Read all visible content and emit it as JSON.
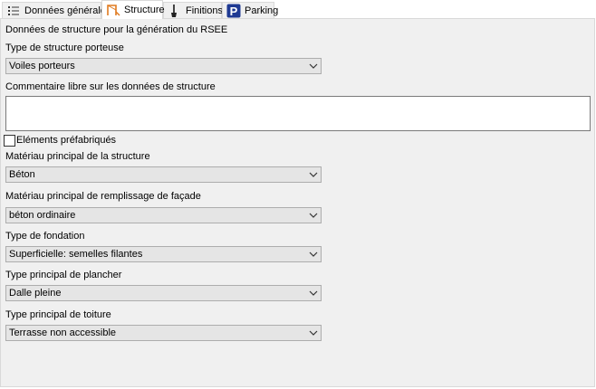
{
  "tabs": [
    {
      "label": "Données générales",
      "icon": "list-icon",
      "active": false
    },
    {
      "label": "Structure",
      "icon": "structure-icon",
      "active": true
    },
    {
      "label": "Finitions",
      "icon": "paint-brush-icon",
      "active": false
    },
    {
      "label": "Parking",
      "icon": "parking-icon",
      "active": false
    }
  ],
  "form": {
    "section_title": "Données de structure pour la génération du RSEE",
    "structure_type": {
      "label": "Type de structure porteuse",
      "value": "Voiles porteurs"
    },
    "comment": {
      "label": "Commentaire libre sur les données de structure",
      "value": ""
    },
    "prefab": {
      "label": "Eléments préfabriqués",
      "checked": false
    },
    "main_material": {
      "label": "Matériau principal de la structure",
      "value": "Béton"
    },
    "facade_fill": {
      "label": "Matériau principal de remplissage de façade",
      "value": "béton ordinaire"
    },
    "foundation": {
      "label": "Type de fondation",
      "value": "Superficielle: semelles filantes"
    },
    "floor_type": {
      "label": "Type principal de plancher",
      "value": "Dalle pleine"
    },
    "roof_type": {
      "label": "Type principal de toiture",
      "value": "Terrasse non accessible"
    }
  },
  "colors": {
    "panel_bg": "#f0f0f0",
    "combo_bg": "#e5e5e5",
    "combo_border": "#adadad",
    "tab_border": "#d9d9d9",
    "parking_icon_bg": "#1f3a93"
  }
}
